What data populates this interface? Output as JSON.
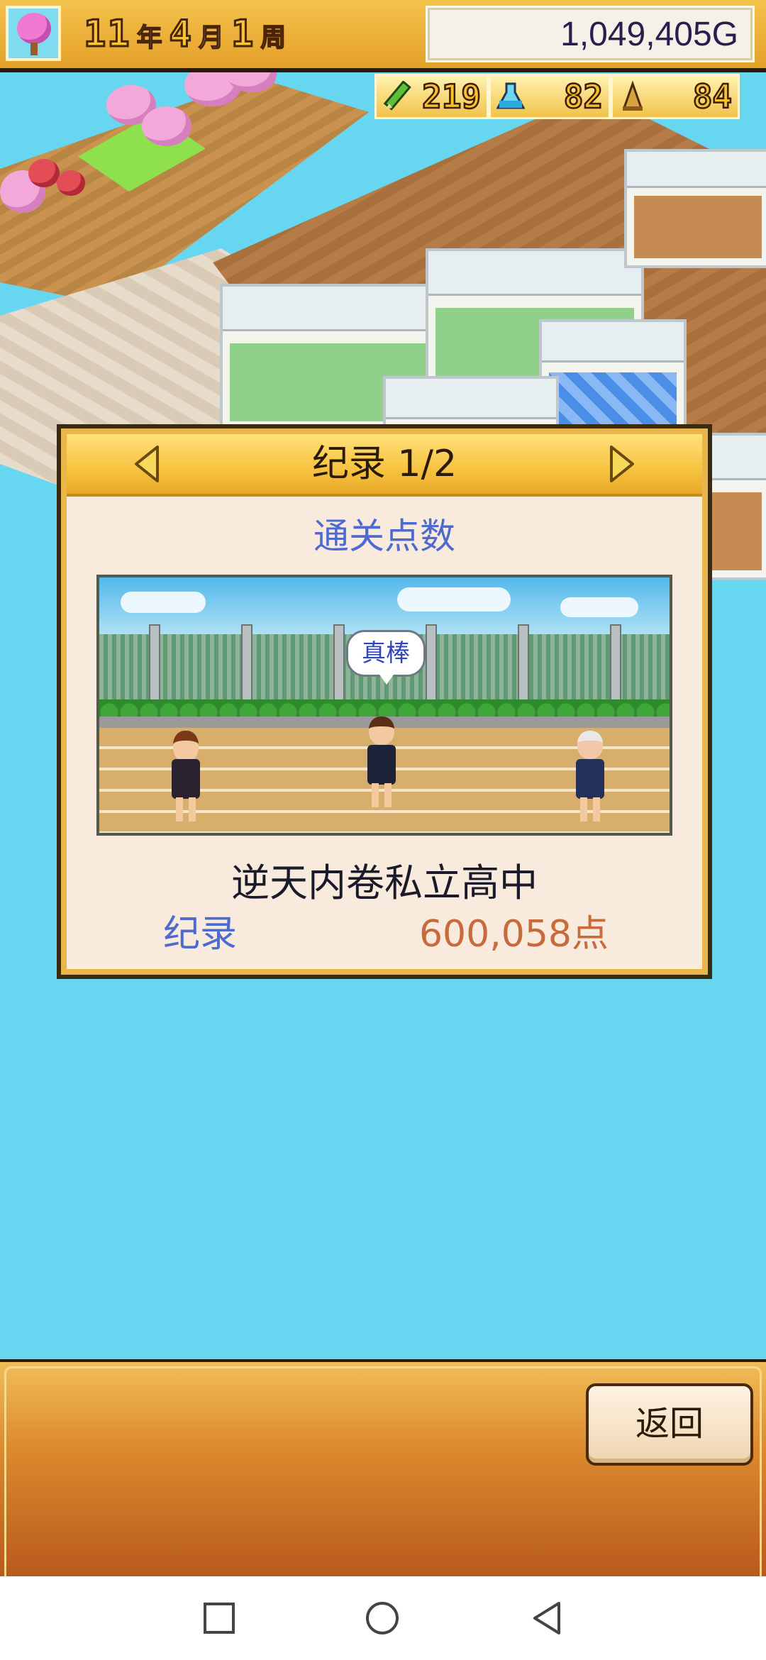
{
  "hud": {
    "year_num": "11",
    "year_unit": "年",
    "month_num": "4",
    "month_unit": "月",
    "week_num": "1",
    "week_unit": "周",
    "money": "1,049,405G",
    "icon": "cherry-tree-icon"
  },
  "stats": [
    {
      "icon": "pencil-icon",
      "value": "219"
    },
    {
      "icon": "flask-icon",
      "value": "82"
    },
    {
      "icon": "trophy-icon",
      "value": "84"
    }
  ],
  "dialog": {
    "title": "纪录 1/2",
    "category": "通关点数",
    "speech_bubble": "真棒",
    "school_name": "逆天内卷私立高中",
    "record_label": "纪录",
    "record_value": "600,058点",
    "accent_color": "#f6c33f"
  },
  "bottom": {
    "back_label": "返回"
  },
  "navbar": {
    "recent": "square-icon",
    "home": "circle-icon",
    "back": "triangle-back-icon"
  }
}
